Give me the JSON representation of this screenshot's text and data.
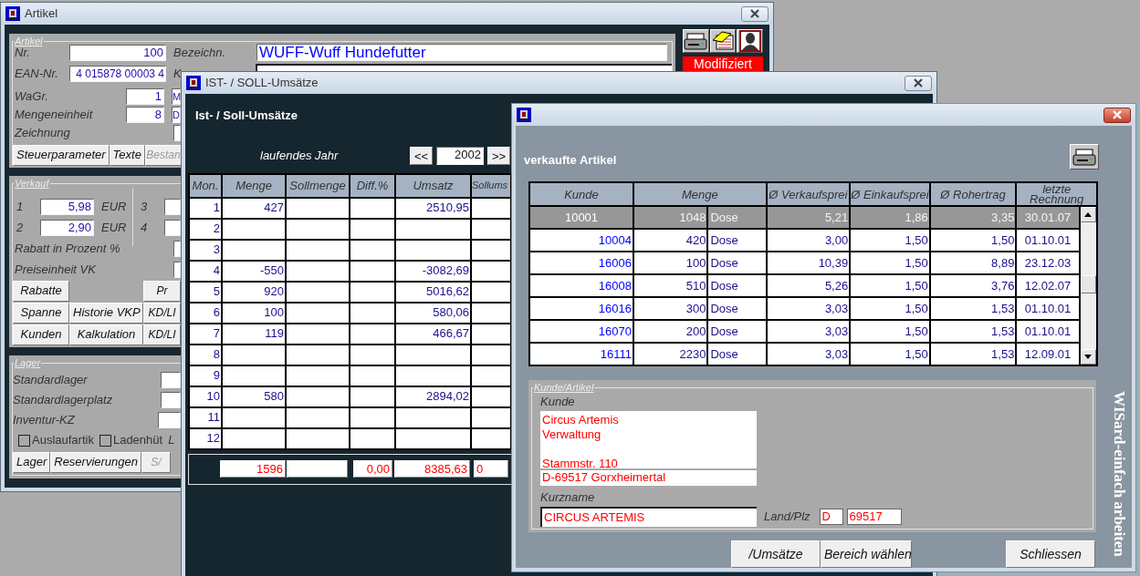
{
  "artikel_window": {
    "title": "Artikel",
    "status_badge": "Modifiziert",
    "artikel_group": {
      "legend": "Artikel",
      "nr": {
        "label": "Nr.",
        "value": "100"
      },
      "bezeichnung": {
        "label": "Bezeichn.",
        "value": "WUFF-Wuff Hundefutter"
      },
      "ean": {
        "label": "EAN-Nr.",
        "value": "4 015878 00003 4"
      },
      "kurztext": {
        "label": "K"
      },
      "wagr": {
        "label": "WaGr.",
        "value": "1",
        "text": "M"
      },
      "mengeneinheit": {
        "label": "Mengeneinheit",
        "value": "8",
        "text": "D"
      },
      "zeichnung": {
        "label": "Zeichnung"
      },
      "buttons": [
        {
          "label": "Steuerparameter",
          "disabled": false
        },
        {
          "label": "Texte",
          "disabled": false
        },
        {
          "label": "Bestan",
          "disabled": true
        }
      ]
    },
    "verkauf_group": {
      "legend": "Verkauf",
      "prices": [
        {
          "label": "1",
          "value": "5,98",
          "currency": "EUR",
          "right_label": "3"
        },
        {
          "label": "2",
          "value": "2,90",
          "currency": "EUR",
          "right_label": "4"
        }
      ],
      "rabatt_label": "Rabatt in Prozent %",
      "preiseinheit_label": "Preiseinheit VK",
      "button_rows": [
        {
          "first": "Rabatte",
          "last": "Pr"
        },
        {
          "first": "Spanne",
          "middle": "Historie VKP",
          "last": "KD/LI"
        },
        {
          "first": "Kunden",
          "middle": "Kalkulation",
          "last": "KD/LI"
        }
      ]
    },
    "lager_group": {
      "legend": "Lager",
      "labels": [
        "Standardlager",
        "Standardlagerplatz",
        "Inventur-KZ"
      ],
      "checkboxes": [
        {
          "label": "Auslaufartik",
          "checked": false
        },
        {
          "label": "Ladenhüt",
          "checked": false
        }
      ],
      "trailing_label": "L",
      "buttons": [
        {
          "label": "Lager",
          "disabled": false
        },
        {
          "label": "Reservierungen",
          "disabled": false
        },
        {
          "label": "S/",
          "disabled": true
        }
      ]
    }
  },
  "umsatz_window": {
    "title": "IST- / SOLL-Umsätze",
    "heading": "Ist- / Soll-Umsätze",
    "year_label": "laufendes Jahr",
    "prev_button": "<<",
    "year": "2002",
    "next_button": ">>",
    "table": {
      "columns": [
        "Mon.",
        "Menge",
        "Sollmenge",
        "Diff.%",
        "Umsatz",
        "Sollums"
      ],
      "rows": [
        {
          "month": "1",
          "menge": "427",
          "umsatz": "2510,95"
        },
        {
          "month": "2"
        },
        {
          "month": "3"
        },
        {
          "month": "4",
          "menge": "-550",
          "umsatz": "-3082,69"
        },
        {
          "month": "5",
          "menge": "920",
          "umsatz": "5016,62"
        },
        {
          "month": "6",
          "menge": "100",
          "umsatz": "580,06"
        },
        {
          "month": "7",
          "menge": "119",
          "umsatz": "466,67"
        },
        {
          "month": "8"
        },
        {
          "month": "9"
        },
        {
          "month": "10",
          "menge": "580",
          "umsatz": "2894,02"
        },
        {
          "month": "11"
        },
        {
          "month": "12"
        }
      ]
    },
    "totals": {
      "menge": "1596",
      "diff": "0,00",
      "umsatz": "8385,63",
      "sollumsatz": "0"
    }
  },
  "verkauf_window": {
    "heading": "verkaufte Artikel",
    "table": {
      "columns": [
        "Kunde",
        "Menge",
        "Ø Verkaufsprei",
        "Ø Einkaufsprei",
        "Ø Rohertrag",
        "letzte Rechnung"
      ],
      "rows": [
        {
          "kunde": "10001",
          "menge": "1048",
          "unit": "Dose",
          "vk": "5,21",
          "ek": "1,86",
          "rohertrag": "3,35",
          "datum": "30.01.07",
          "selected": true
        },
        {
          "kunde": "10004",
          "menge": "420",
          "unit": "Dose",
          "vk": "3,00",
          "ek": "1,50",
          "rohertrag": "1,50",
          "datum": "01.10.01",
          "selected": false
        },
        {
          "kunde": "16006",
          "menge": "100",
          "unit": "Dose",
          "vk": "10,39",
          "ek": "1,50",
          "rohertrag": "8,89",
          "datum": "23.12.03",
          "selected": false
        },
        {
          "kunde": "16008",
          "menge": "510",
          "unit": "Dose",
          "vk": "5,26",
          "ek": "1,50",
          "rohertrag": "3,76",
          "datum": "12.02.07",
          "selected": false
        },
        {
          "kunde": "16016",
          "menge": "300",
          "unit": "Dose",
          "vk": "3,03",
          "ek": "1,50",
          "rohertrag": "1,53",
          "datum": "01.10.01",
          "selected": false
        },
        {
          "kunde": "16070",
          "menge": "200",
          "unit": "Dose",
          "vk": "3,03",
          "ek": "1,50",
          "rohertrag": "1,53",
          "datum": "01.10.01",
          "selected": false
        },
        {
          "kunde": "16111",
          "menge": "2230",
          "unit": "Dose",
          "vk": "3,03",
          "ek": "1,50",
          "rohertrag": "1,53",
          "datum": "12.09.01",
          "selected": false
        }
      ]
    },
    "kunde_group": {
      "legend": "Kunde/Artikel",
      "kunde_label": "Kunde",
      "address": "Circus Artemis\nVerwaltung\n\nStammstr. 110",
      "city": "D-69517 Gorxheimertal",
      "kurzname_label": "Kurzname",
      "kurzname": "CIRCUS ARTEMIS",
      "land_plz_label": "Land/Plz",
      "land": "D",
      "plz": "69517"
    },
    "buttons": [
      "/Umsätze",
      "Bereich wählen",
      "Schliessen"
    ],
    "brand": "WISard-einfach arbeiten"
  }
}
